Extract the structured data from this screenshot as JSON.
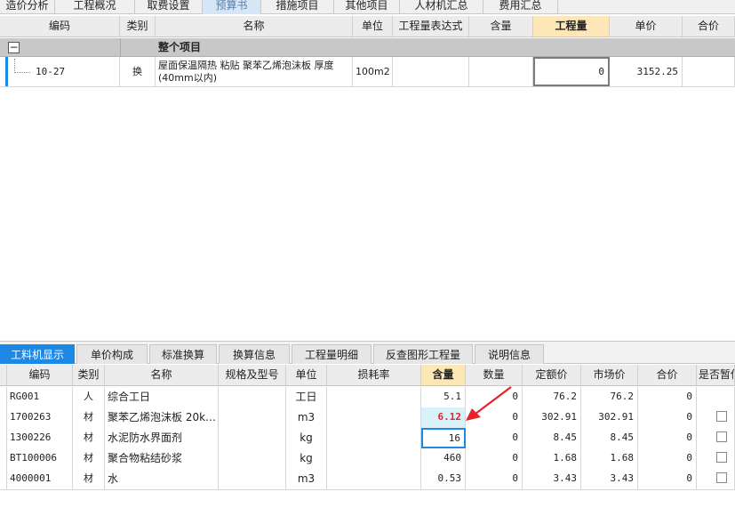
{
  "top_tabs": [
    {
      "label": "造价分析"
    },
    {
      "label": "工程概况"
    },
    {
      "label": "取费设置"
    },
    {
      "label": "预算书"
    },
    {
      "label": "措施项目"
    },
    {
      "label": "其他项目"
    },
    {
      "label": "人材机汇总"
    },
    {
      "label": "费用汇总"
    }
  ],
  "upper_grid": {
    "headers": [
      "编码",
      "类别",
      "名称",
      "单位",
      "工程量表达式",
      "含量",
      "工程量",
      "单价",
      "合价"
    ],
    "group_row": {
      "toggle": "−",
      "label": "整个项目"
    },
    "row": {
      "code": "10-27",
      "type": "换",
      "name": "屋面保温隔热 粘贴 聚苯乙烯泡沫板 厚度(40mm以内)",
      "unit": "100m2",
      "expression": "",
      "content": "",
      "quantity": "0",
      "price": "3152.25",
      "total": ""
    }
  },
  "lower_tabs": [
    {
      "label": "工料机显示"
    },
    {
      "label": "单价构成"
    },
    {
      "label": "标准换算"
    },
    {
      "label": "换算信息"
    },
    {
      "label": "工程量明细"
    },
    {
      "label": "反查图形工程量"
    },
    {
      "label": "说明信息"
    }
  ],
  "lower_grid": {
    "headers": [
      "编码",
      "类别",
      "名称",
      "规格及型号",
      "单位",
      "损耗率",
      "含量",
      "数量",
      "定额价",
      "市场价",
      "合价",
      "是否暂估"
    ],
    "rows": [
      {
        "code": "RG001",
        "type": "人",
        "name": "综合工日",
        "spec": "",
        "unit": "工日",
        "loss": "",
        "content": "5.1",
        "qty": "0",
        "quota": "76.2",
        "market": "76.2",
        "total": "0",
        "checkbox": false
      },
      {
        "code": "1700263",
        "type": "材",
        "name": "聚苯乙烯泡沫板 20k…",
        "spec": "",
        "unit": "m3",
        "loss": "",
        "content": "6.12",
        "qty": "0",
        "quota": "302.91",
        "market": "302.91",
        "total": "0",
        "checkbox": true
      },
      {
        "code": "1300226",
        "type": "材",
        "name": "水泥防水界面剂",
        "spec": "",
        "unit": "kg",
        "loss": "",
        "content": "16",
        "qty": "0",
        "quota": "8.45",
        "market": "8.45",
        "total": "0",
        "checkbox": true
      },
      {
        "code": "BT100006",
        "type": "材",
        "name": "聚合物粘结砂浆",
        "spec": "",
        "unit": "kg",
        "loss": "",
        "content": "460",
        "qty": "0",
        "quota": "1.68",
        "market": "1.68",
        "total": "0",
        "checkbox": true
      },
      {
        "code": "4000001",
        "type": "材",
        "name": "水",
        "spec": "",
        "unit": "m3",
        "loss": "",
        "content": "0.53",
        "qty": "0",
        "quota": "3.43",
        "market": "3.43",
        "total": "0",
        "checkbox": true
      }
    ]
  },
  "colors": {
    "accent": "#1e88e5",
    "header_highlight": "#fde7b8",
    "annotation_arrow": "#e8212b",
    "highlight_value": "#e8212b"
  }
}
